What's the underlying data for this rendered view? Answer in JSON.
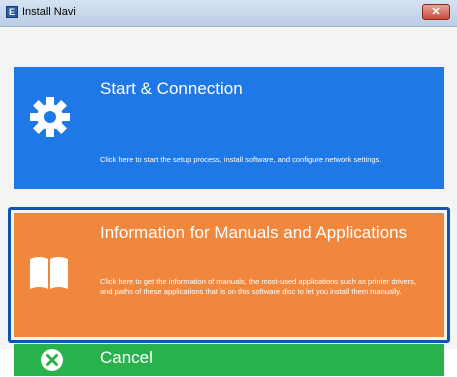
{
  "window": {
    "title": "Install Navi",
    "app_icon_glyph": "E",
    "close_glyph": "✕"
  },
  "options": {
    "start": {
      "title": "Start & Connection",
      "description": "Click here to start the setup process, install software, and configure network settings.",
      "icon": "gear-icon",
      "color": "#1e78e6"
    },
    "info": {
      "title": "Information for Manuals and Applications",
      "description": "Click here to get the information of manuals, the most-used applications such as printer drivers, and paths of these applications that is on this software disc to let you install them manually.",
      "icon": "book-icon",
      "color": "#f0873c",
      "selected": true
    },
    "cancel": {
      "title": "Cancel",
      "icon": "cancel-icon",
      "color": "#29b24c"
    }
  }
}
